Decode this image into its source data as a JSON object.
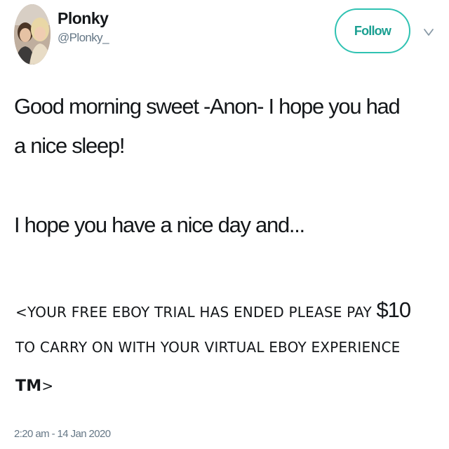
{
  "user": {
    "display_name": "Plonky",
    "handle": "@Plonky_"
  },
  "follow_label": "Follow",
  "tweet": {
    "line1": "Good morning sweet -Anon- I hope you had",
    "line2": "a nice sleep!",
    "line3": "I hope you have a nice day and...",
    "caps_line1_prefix": "<YOUR FREE EBOY TRIAL HAS ENDED PLEASE PAY ",
    "caps_line1_amount": "$10",
    "caps_line2": "TO CARRY ON WITH YOUR VIRTUAL EBOY EXPERIENCE",
    "caps_line3_tm": "TM",
    "caps_line3_end": ">"
  },
  "timestamp": "2:20 am - 14 Jan 2020",
  "icons": {
    "menu": "chevron-down-icon"
  },
  "colors": {
    "accent": "#2fc2b2",
    "text": "#14171a",
    "muted": "#657786"
  }
}
